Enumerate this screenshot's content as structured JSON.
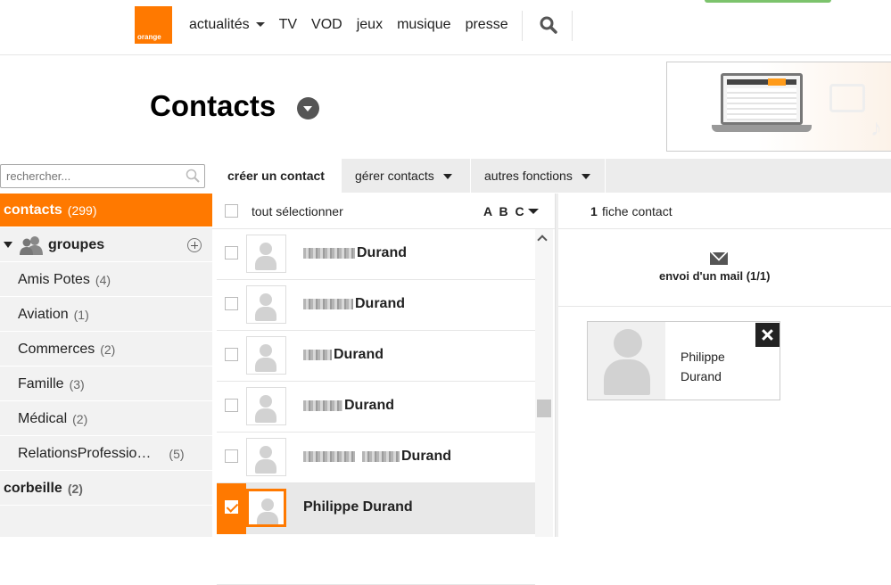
{
  "brand": {
    "logo_text": "orange",
    "accent": "#ff7900"
  },
  "nav": {
    "items": [
      "actualités",
      "TV",
      "VOD",
      "jeux",
      "musique",
      "presse"
    ]
  },
  "header": {
    "title": "Contacts"
  },
  "toolbar": {
    "create": "créer un contact",
    "manage": "gérer contacts",
    "other": "autres fonctions"
  },
  "search": {
    "placeholder": "rechercher..."
  },
  "sidebar": {
    "contacts": {
      "label": "contacts",
      "count": "(299)"
    },
    "groupes": "groupes",
    "groups": [
      {
        "label": "Amis Potes",
        "count": "(4)"
      },
      {
        "label": "Aviation",
        "count": "(1)"
      },
      {
        "label": "Commerces",
        "count": "(2)"
      },
      {
        "label": "Famille",
        "count": "(3)"
      },
      {
        "label": "Médical",
        "count": "(2)"
      },
      {
        "label": "RelationsProfessio…",
        "count": "(5)"
      }
    ],
    "corbeille": {
      "label": "corbeille",
      "count": "(2)"
    }
  },
  "list": {
    "select_all": "tout sélectionner",
    "sort": "A B C",
    "rows": [
      {
        "name": "Durand",
        "selected": false
      },
      {
        "name": "Durand",
        "selected": false
      },
      {
        "name": "Durand",
        "selected": false
      },
      {
        "name": "Durand",
        "selected": false
      },
      {
        "name": "Durand",
        "selected": false
      },
      {
        "name": "Philippe Durand",
        "selected": true
      }
    ]
  },
  "panel": {
    "count": "1",
    "count_label": "fiche contact",
    "mail_action": "envoi d'un mail (1/1)",
    "card_first": "Philippe",
    "card_last": "Durand"
  }
}
